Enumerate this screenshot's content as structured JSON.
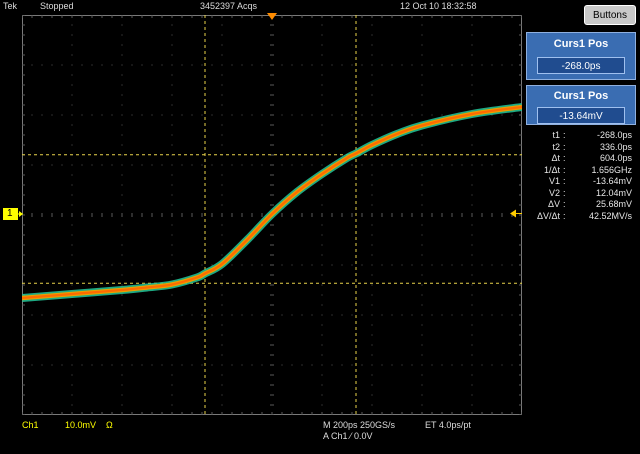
{
  "header": {
    "brand": "Tek",
    "status": "Stopped",
    "acqs": "3452397 Acqs",
    "datetime": "12 Oct 10 18:32:58",
    "buttons_label": "Buttons"
  },
  "panels": {
    "curs1_time": {
      "title": "Curs1 Pos",
      "value": "-268.0ps"
    },
    "curs1_volt": {
      "title": "Curs1 Pos",
      "value": "-13.64mV"
    }
  },
  "measurements": [
    {
      "label": "t1",
      "value": "-268.0ps"
    },
    {
      "label": "t2",
      "value": "336.0ps"
    },
    {
      "label": "Δt",
      "value": "604.0ps"
    },
    {
      "label": "1/Δt",
      "value": "1.656GHz"
    },
    {
      "label": "V1",
      "value": "-13.64mV"
    },
    {
      "label": "V2",
      "value": "12.04mV"
    },
    {
      "label": "ΔV",
      "value": "25.68mV"
    },
    {
      "label": "ΔV/Δt",
      "value": "42.52MV/s"
    }
  ],
  "channel": {
    "marker": "1",
    "name": "Ch1",
    "scale": "10.0mV",
    "coupling": "Ω"
  },
  "timebase": {
    "main": "M 200ps 250GS/s",
    "et": "ET 4.0ps/pt",
    "trigger": "A  Ch1  ⁄  0.0V"
  },
  "colors": {
    "background": "#000000",
    "graticule": "#5a5a5a",
    "trace_outer": "#22c79a",
    "trace_inner": "#ff6a00",
    "cursor": "#e8d24a",
    "channel": "#ffff00",
    "panel": "#3a6db2",
    "trigger_marker": "#ff8c00"
  },
  "waveform": {
    "type": "step-response",
    "x_unit": "ps",
    "y_unit": "mV",
    "x_range": [
      -1000,
      1000
    ],
    "y_range": [
      -40,
      40
    ],
    "points": [
      [
        -1000,
        -16.6
      ],
      [
        -800,
        -15.8
      ],
      [
        -600,
        -15.0
      ],
      [
        -500,
        -14.5
      ],
      [
        -400,
        -13.9
      ],
      [
        -300,
        -12.5
      ],
      [
        -268,
        -11.7
      ],
      [
        -200,
        -9.8
      ],
      [
        -100,
        -5.0
      ],
      [
        0,
        0.2
      ],
      [
        100,
        4.6
      ],
      [
        200,
        8.2
      ],
      [
        300,
        11.4
      ],
      [
        336,
        12.3
      ],
      [
        400,
        14.0
      ],
      [
        500,
        16.2
      ],
      [
        600,
        17.9
      ],
      [
        800,
        20.2
      ],
      [
        1000,
        21.6
      ]
    ]
  },
  "cursors": {
    "t1": -268,
    "t2": 336,
    "v1": -13.64,
    "v2": 12.04
  }
}
